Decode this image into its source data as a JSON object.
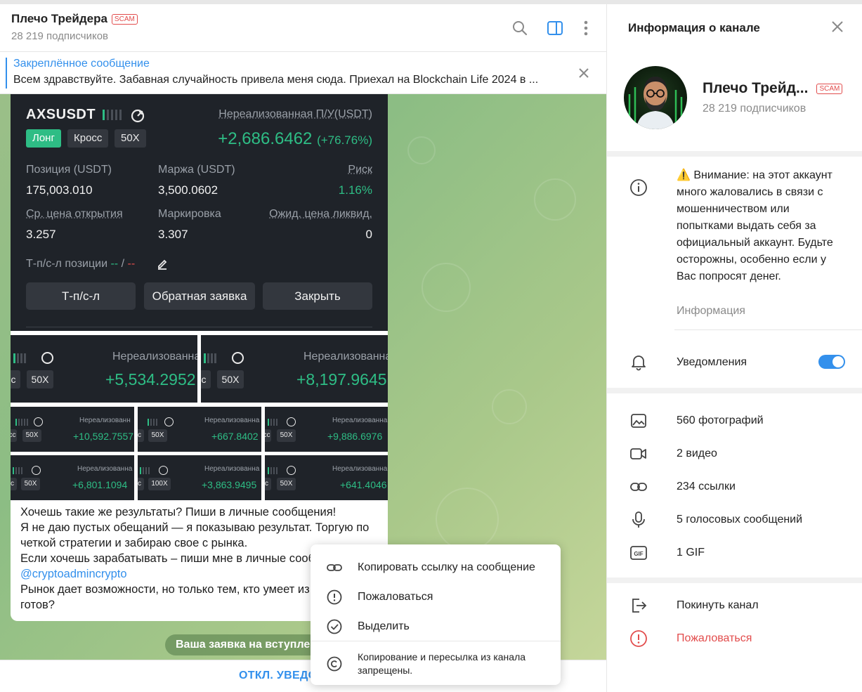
{
  "chat": {
    "title": "Плечо Трейдера",
    "scam_badge": "SCAM",
    "subscribers": "28 219 подписчиков",
    "icons": [
      "search-icon",
      "sidebar-toggle-icon",
      "more-vertical-icon"
    ]
  },
  "pinned": {
    "title": "Закреплённое сообщение",
    "text": "Всем здравствуйте. Забавная случайность привела меня сюда. Приехал на Blockchain Life 2024 в ..."
  },
  "trade_main": {
    "symbol": "AXSUSDT",
    "tags": [
      "Лонг",
      "Кросс",
      "50X"
    ],
    "unrealized_label": "Нереализованная П/У(USDT)",
    "unrealized_value": "+2,686.6462",
    "unrealized_pct": "(+76.76%)",
    "position_label": "Позиция (USDT)",
    "position_value": "175,003.010",
    "margin_label": "Маржа (USDT)",
    "margin_value": "3,500.0602",
    "risk_label": "Риск",
    "risk_value": "1.16%",
    "entry_label": "Ср. цена открытия",
    "entry_value": "3.257",
    "mark_label": "Маркировка",
    "mark_value": "3.307",
    "liq_label": "Ожид. цена ликвид.",
    "liq_value": "0",
    "tpsl_label": "Т-п/с-л позиции",
    "tpsl_dash1": "--",
    "tpsl_slash": "/",
    "tpsl_dash2": "--",
    "btn_tpsl": "Т-п/с-л",
    "btn_reverse": "Обратная заявка",
    "btn_close": "Закрыть"
  },
  "tiles": [
    {
      "label": "Нереализованна",
      "tag_left": "c",
      "tag": "50X",
      "value": "+5,534.2952"
    },
    {
      "label": "Нереализованна",
      "tag_left": "c",
      "tag": "50X",
      "value": "+8,197.9645"
    },
    {
      "label": "Нереализованн",
      "tag_left": "cc",
      "tag": "50X",
      "value": "+10,592.7557"
    },
    {
      "label": "Нереализованна",
      "tag_left": "c",
      "tag": "50X",
      "value": "+667.8402"
    },
    {
      "label": "Нереализованна",
      "tag_left": "cc",
      "tag": "50X",
      "value": "+9,886.6976"
    },
    {
      "label": "Нереализованна",
      "tag_left": "c",
      "tag": "50X",
      "value": "+6,801.1094"
    },
    {
      "label": "Нереализованна",
      "tag_left": "c",
      "tag": "100X",
      "value": "+3,863.9495"
    },
    {
      "label": "Нереализованна",
      "tag_left": "c",
      "tag": "50X",
      "value": "+641.4046"
    }
  ],
  "message": {
    "line1": "Хочешь такие же результаты? Пиши в личные сообщения!",
    "line2": "Я не даю пустых обещаний — я показываю результат. Торгую по четкой стратегии и забираю свое с рынка.",
    "line3": "Если хочешь зарабатывать – пиши мне в личные сооб",
    "mention": "@cryptoadmincrypto",
    "line4": "Рынок дает возможности, но только тем, кто умеет из",
    "line5": "готов?"
  },
  "join_pill": "Ваша заявка на вступле",
  "bottom_button": "ОТКЛ. УВЕДО",
  "context_menu": {
    "copy_link": "Копировать ссылку на сообщение",
    "report": "Пожаловаться",
    "select": "Выделить",
    "note": "Копирование и пересылка из канала запрещены."
  },
  "info": {
    "title": "Информация о канале",
    "channel_name": "Плечо Трейд...",
    "scam_badge": "SCAM",
    "subscribers": "28 219 подписчиков",
    "warning": "⚠️ Внимание: на этот аккаунт много жаловались в связи с мошенничеством или попытками выдать себя за официальный аккаунт. Будьте осторожны, особенно если у Вас попросят денег.",
    "info_label": "Информация",
    "notifications": "Уведомления",
    "notifications_on": true,
    "media": {
      "photos": "560 фотографий",
      "videos": "2 видео",
      "links": "234 ссылки",
      "voice": "5 голосовых сообщений",
      "gif": "1 GIF",
      "gif_icon_label": "GIF"
    },
    "leave": "Покинуть канал",
    "report": "Пожаловаться"
  },
  "colors": {
    "accent": "#3390ec",
    "profit_green": "#2ebd85",
    "danger": "#e24c4c",
    "dark_card": "#1f2329"
  }
}
